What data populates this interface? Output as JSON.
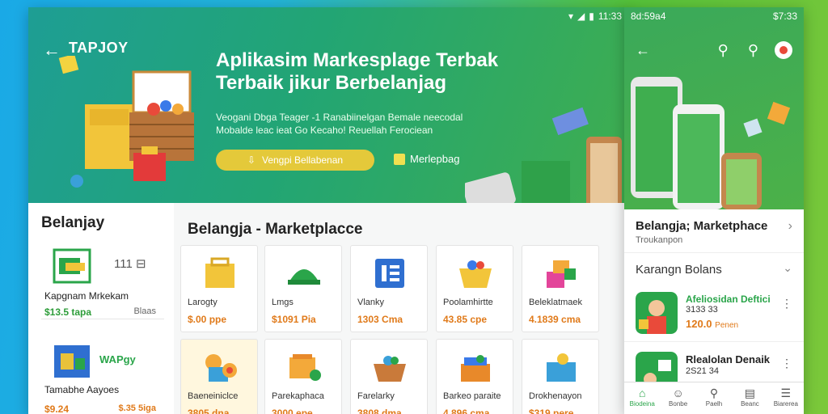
{
  "main": {
    "status": {
      "time": "11:33"
    },
    "brand": "TAPJOY",
    "hero": {
      "title_line1": "Aplikasim Markesplage Terbak",
      "title_line2": "Terbaik jikur Berbelanjag",
      "subtitle_line1": "Veogani Dbga Teager -1 Ranabiinelgan Bemale neecodal",
      "subtitle_line2": "Mobalde leac ieat Go Kecaho! Reuellah Ferociean",
      "button_label": "Vengpi Bellabenan",
      "link_label": "Merlepbag"
    },
    "sidebar": {
      "title": "Belanjay",
      "cards": [
        {
          "meta": "111 ⊟",
          "name": "Kapgnam Mrkekam",
          "price": "$13.5 tapa",
          "extra": "Blaas"
        },
        {
          "meta": "WAPgy",
          "name": "Tamabhe Aayoes",
          "price": "$9.24",
          "extra": "$.35 5iga"
        }
      ]
    },
    "market": {
      "title": "Belangja - Marketplacce",
      "tiles": [
        {
          "name": "Larogty",
          "price": "$.00 ppe"
        },
        {
          "name": "Lmgs",
          "price": "$1091 Pia"
        },
        {
          "name": "Vlanky",
          "price": "1303 Cma"
        },
        {
          "name": "Poolamhirtte",
          "price": "43.85 cpe"
        },
        {
          "name": "Beleklatmaek",
          "price": "4.1839 cma"
        },
        {
          "name": "Baeneiniclce",
          "price": "3805 dna"
        },
        {
          "name": "Parekaphaca",
          "price": "3000 epe"
        },
        {
          "name": "Farelarky",
          "price": "3808 dma"
        },
        {
          "name": "Barkeo paraite",
          "price": "4.896 cma"
        },
        {
          "name": "Drokhenayon",
          "price": "$319 pere"
        }
      ]
    }
  },
  "phone": {
    "status": {
      "left": "8d:59a4",
      "right": "$7:33"
    },
    "section1": {
      "title": "Belangja; Marketphace",
      "subtitle": "Troukanpon"
    },
    "section2": {
      "title": "Karangn Bolans"
    },
    "apps": [
      {
        "name": "Afeliosidan Deftici",
        "num": "3133 33",
        "price": "120.0",
        "unit": "Penen"
      },
      {
        "name": "Rlealolan Denaik",
        "num": "2S21 34",
        "price": "",
        "unit": ""
      }
    ],
    "tabs": [
      {
        "label": "Biodeina",
        "icon": "⌂"
      },
      {
        "label": "Bonbe",
        "icon": "☺"
      },
      {
        "label": "Paelh",
        "icon": "⚲"
      },
      {
        "label": "Beanc",
        "icon": "▤"
      },
      {
        "label": "Biarerea",
        "icon": "☰"
      }
    ]
  },
  "colors": {
    "accent_green": "#2aa54a",
    "price_orange": "#e07a1a",
    "hero_green": "#22a574"
  }
}
